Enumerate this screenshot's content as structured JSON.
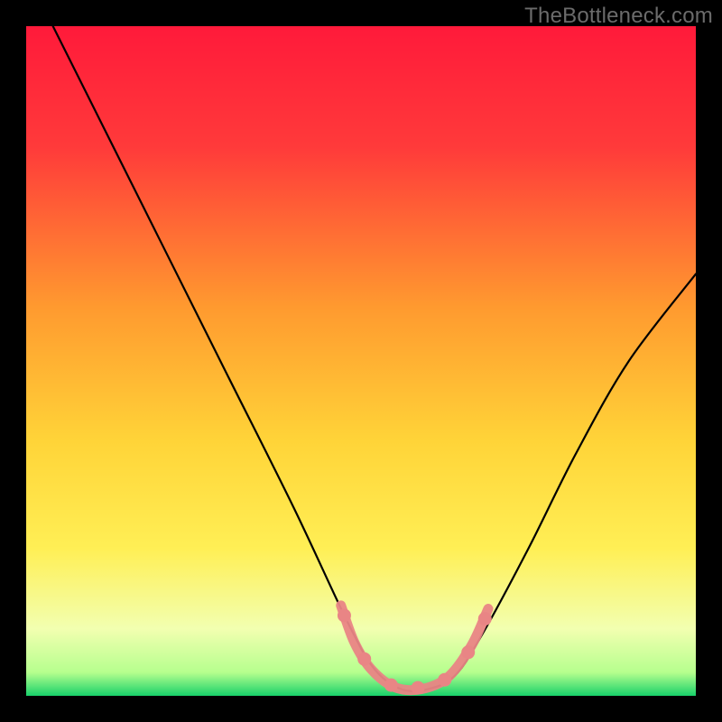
{
  "watermark": "TheBottleneck.com",
  "colors": {
    "frame": "#000000",
    "watermark_text": "#6b6b6b",
    "gradient_top": "#ff1a3a",
    "gradient_mid_orange": "#ff8a2b",
    "gradient_mid_yellow": "#ffe440",
    "gradient_pale": "#f6ffbf",
    "gradient_green": "#18d16a",
    "curve_stroke": "#000000",
    "marker_fill": "#e98585",
    "marker_stroke_alt": "#9dbf7a"
  },
  "chart_data": {
    "type": "line",
    "title": "",
    "xlabel": "",
    "ylabel": "",
    "xlim": [
      0,
      100
    ],
    "ylim": [
      0,
      100
    ],
    "grid": false,
    "legend": false,
    "series": [
      {
        "name": "bottleneck-curve",
        "x": [
          4,
          10,
          20,
          30,
          40,
          48,
          52,
          56,
          60,
          64,
          68,
          75,
          82,
          90,
          100
        ],
        "values": [
          100,
          88,
          68,
          48,
          28,
          11,
          4,
          1,
          1,
          3,
          9,
          22,
          36,
          50,
          63
        ]
      }
    ],
    "markers": {
      "name": "highlight-dots",
      "x": [
        47.5,
        50.5,
        54.5,
        58.5,
        62.5,
        66.0,
        68.5
      ],
      "y": [
        12.0,
        5.5,
        1.6,
        1.2,
        2.4,
        6.5,
        11.5
      ]
    },
    "marker_trace": {
      "name": "highlight-stroke",
      "x": [
        47.0,
        49.0,
        51.5,
        55.0,
        59.0,
        63.0,
        66.5,
        69.0
      ],
      "y": [
        13.5,
        8.0,
        4.0,
        1.3,
        1.0,
        2.8,
        7.5,
        13.0
      ]
    },
    "gradient_stops": [
      {
        "offset": 0.0,
        "color": "#ff1a3a"
      },
      {
        "offset": 0.18,
        "color": "#ff3a3a"
      },
      {
        "offset": 0.42,
        "color": "#ff9a2f"
      },
      {
        "offset": 0.62,
        "color": "#ffd438"
      },
      {
        "offset": 0.78,
        "color": "#ffef55"
      },
      {
        "offset": 0.9,
        "color": "#f2ffb0"
      },
      {
        "offset": 0.965,
        "color": "#b6ff8e"
      },
      {
        "offset": 1.0,
        "color": "#18d16a"
      }
    ]
  }
}
